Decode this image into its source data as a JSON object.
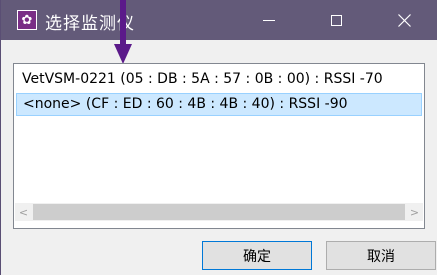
{
  "window": {
    "title": "选择监测仪",
    "icon_name": "paw-icon",
    "controls": [
      "minimize-icon",
      "maximize-icon",
      "close-icon"
    ]
  },
  "devices": [
    {
      "label": "VetVSM-0221 (05 : DB : 5A : 57 : 0B : 00) : RSSI -70",
      "selected": false
    },
    {
      "label": "<none> (CF : ED : 60 : 4B : 4B : 40) : RSSI -90",
      "selected": true
    }
  ],
  "buttons": {
    "ok_label": "确定",
    "cancel_label": "取消"
  },
  "colors": {
    "titlebar": "#635a79",
    "selection": "#cce8ff",
    "annotation_arrow": "#5b1a8a"
  }
}
